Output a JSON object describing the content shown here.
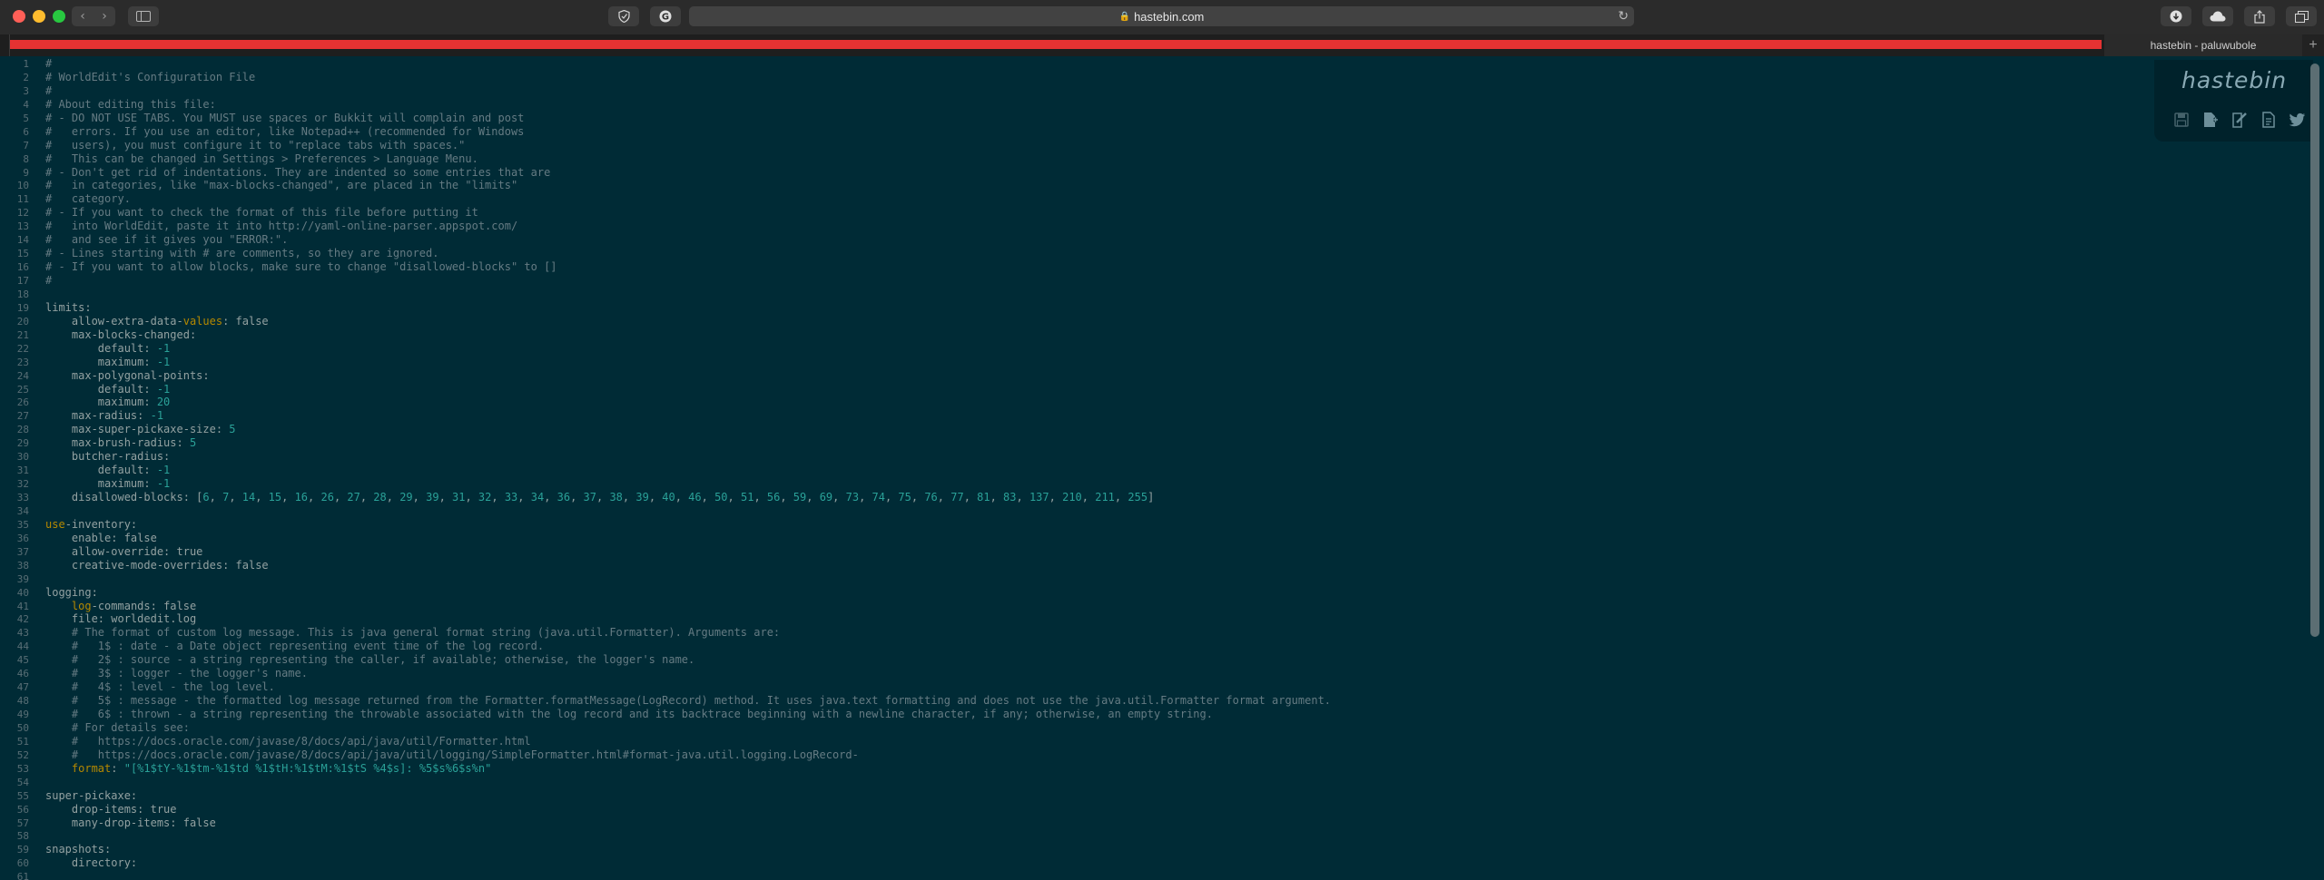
{
  "browser": {
    "url": "hastebin.com",
    "tab_title": "hastebin - paluwubole",
    "nav_back": "‹",
    "nav_forward": "›",
    "new_tab": "+"
  },
  "hastebin": {
    "logo": "hastebin",
    "icons": [
      "save-icon",
      "new-icon",
      "duplicate-icon",
      "raw-icon",
      "twitter-icon"
    ]
  },
  "code_lines": [
    {
      "n": "1",
      "parts": [
        [
          "cmt",
          "#"
        ]
      ]
    },
    {
      "n": "2",
      "parts": [
        [
          "cmt",
          "# WorldEdit's Configuration File"
        ]
      ]
    },
    {
      "n": "3",
      "parts": [
        [
          "cmt",
          "#"
        ]
      ]
    },
    {
      "n": "4",
      "parts": [
        [
          "cmt",
          "# About editing this file:"
        ]
      ]
    },
    {
      "n": "5",
      "parts": [
        [
          "cmt",
          "# - DO NOT USE TABS. You MUST use spaces or Bukkit will complain and post"
        ]
      ]
    },
    {
      "n": "6",
      "parts": [
        [
          "cmt",
          "#   errors. If you use an editor, like Notepad++ (recommended for Windows"
        ]
      ]
    },
    {
      "n": "7",
      "parts": [
        [
          "cmt",
          "#   users), you must configure it to \"replace tabs with spaces.\""
        ]
      ]
    },
    {
      "n": "8",
      "parts": [
        [
          "cmt",
          "#   This can be changed in Settings > Preferences > Language Menu."
        ]
      ]
    },
    {
      "n": "9",
      "parts": [
        [
          "cmt",
          "# - Don't get rid of indentations. They are indented so some entries that are"
        ]
      ]
    },
    {
      "n": "10",
      "parts": [
        [
          "cmt",
          "#   in categories, like \"max-blocks-changed\", are placed in the \"limits\""
        ]
      ]
    },
    {
      "n": "11",
      "parts": [
        [
          "cmt",
          "#   category."
        ]
      ]
    },
    {
      "n": "12",
      "parts": [
        [
          "cmt",
          "# - If you want to check the format of this file before putting it"
        ]
      ]
    },
    {
      "n": "13",
      "parts": [
        [
          "cmt",
          "#   into WorldEdit, paste it into http://yaml-online-parser.appspot.com/"
        ]
      ]
    },
    {
      "n": "14",
      "parts": [
        [
          "cmt",
          "#   and see if it gives you \"ERROR:\"."
        ]
      ]
    },
    {
      "n": "15",
      "parts": [
        [
          "cmt",
          "# - Lines starting with # are comments, so they are ignored."
        ]
      ]
    },
    {
      "n": "16",
      "parts": [
        [
          "cmt",
          "# - If you want to allow blocks, make sure to change \"disallowed-blocks\" to []"
        ]
      ]
    },
    {
      "n": "17",
      "parts": [
        [
          "cmt",
          "#"
        ]
      ]
    },
    {
      "n": "18",
      "parts": []
    },
    {
      "n": "19",
      "parts": [
        [
          "t",
          "limits:"
        ]
      ]
    },
    {
      "n": "20",
      "parts": [
        [
          "t",
          "    allow-extra-data-"
        ],
        [
          "kw",
          "values"
        ],
        [
          "t",
          ": false"
        ]
      ]
    },
    {
      "n": "21",
      "parts": [
        [
          "t",
          "    max-blocks-changed:"
        ]
      ]
    },
    {
      "n": "22",
      "parts": [
        [
          "t",
          "        default: "
        ],
        [
          "num",
          "-1"
        ]
      ]
    },
    {
      "n": "23",
      "parts": [
        [
          "t",
          "        maximum: "
        ],
        [
          "num",
          "-1"
        ]
      ]
    },
    {
      "n": "24",
      "parts": [
        [
          "t",
          "    max-polygonal-points:"
        ]
      ]
    },
    {
      "n": "25",
      "parts": [
        [
          "t",
          "        default: "
        ],
        [
          "num",
          "-1"
        ]
      ]
    },
    {
      "n": "26",
      "parts": [
        [
          "t",
          "        maximum: "
        ],
        [
          "num",
          "20"
        ]
      ]
    },
    {
      "n": "27",
      "parts": [
        [
          "t",
          "    max-radius: "
        ],
        [
          "num",
          "-1"
        ]
      ]
    },
    {
      "n": "28",
      "parts": [
        [
          "t",
          "    max-super-pickaxe-size: "
        ],
        [
          "num",
          "5"
        ]
      ]
    },
    {
      "n": "29",
      "parts": [
        [
          "t",
          "    max-brush-radius: "
        ],
        [
          "num",
          "5"
        ]
      ]
    },
    {
      "n": "30",
      "parts": [
        [
          "t",
          "    butcher-radius:"
        ]
      ]
    },
    {
      "n": "31",
      "parts": [
        [
          "t",
          "        default: "
        ],
        [
          "num",
          "-1"
        ]
      ]
    },
    {
      "n": "32",
      "parts": [
        [
          "t",
          "        maximum: "
        ],
        [
          "num",
          "-1"
        ]
      ]
    },
    {
      "n": "33",
      "parts": [
        [
          "t",
          "    disallowed-blocks: ["
        ],
        [
          "num",
          "6"
        ],
        [
          "t",
          ", "
        ],
        [
          "num",
          "7"
        ],
        [
          "t",
          ", "
        ],
        [
          "num",
          "14"
        ],
        [
          "t",
          ", "
        ],
        [
          "num",
          "15"
        ],
        [
          "t",
          ", "
        ],
        [
          "num",
          "16"
        ],
        [
          "t",
          ", "
        ],
        [
          "num",
          "26"
        ],
        [
          "t",
          ", "
        ],
        [
          "num",
          "27"
        ],
        [
          "t",
          ", "
        ],
        [
          "num",
          "28"
        ],
        [
          "t",
          ", "
        ],
        [
          "num",
          "29"
        ],
        [
          "t",
          ", "
        ],
        [
          "num",
          "39"
        ],
        [
          "t",
          ", "
        ],
        [
          "num",
          "31"
        ],
        [
          "t",
          ", "
        ],
        [
          "num",
          "32"
        ],
        [
          "t",
          ", "
        ],
        [
          "num",
          "33"
        ],
        [
          "t",
          ", "
        ],
        [
          "num",
          "34"
        ],
        [
          "t",
          ", "
        ],
        [
          "num",
          "36"
        ],
        [
          "t",
          ", "
        ],
        [
          "num",
          "37"
        ],
        [
          "t",
          ", "
        ],
        [
          "num",
          "38"
        ],
        [
          "t",
          ", "
        ],
        [
          "num",
          "39"
        ],
        [
          "t",
          ", "
        ],
        [
          "num",
          "40"
        ],
        [
          "t",
          ", "
        ],
        [
          "num",
          "46"
        ],
        [
          "t",
          ", "
        ],
        [
          "num",
          "50"
        ],
        [
          "t",
          ", "
        ],
        [
          "num",
          "51"
        ],
        [
          "t",
          ", "
        ],
        [
          "num",
          "56"
        ],
        [
          "t",
          ", "
        ],
        [
          "num",
          "59"
        ],
        [
          "t",
          ", "
        ],
        [
          "num",
          "69"
        ],
        [
          "t",
          ", "
        ],
        [
          "num",
          "73"
        ],
        [
          "t",
          ", "
        ],
        [
          "num",
          "74"
        ],
        [
          "t",
          ", "
        ],
        [
          "num",
          "75"
        ],
        [
          "t",
          ", "
        ],
        [
          "num",
          "76"
        ],
        [
          "t",
          ", "
        ],
        [
          "num",
          "77"
        ],
        [
          "t",
          ", "
        ],
        [
          "num",
          "81"
        ],
        [
          "t",
          ", "
        ],
        [
          "num",
          "83"
        ],
        [
          "t",
          ", "
        ],
        [
          "num",
          "137"
        ],
        [
          "t",
          ", "
        ],
        [
          "num",
          "210"
        ],
        [
          "t",
          ", "
        ],
        [
          "num",
          "211"
        ],
        [
          "t",
          ", "
        ],
        [
          "num",
          "255"
        ],
        [
          "t",
          "]"
        ]
      ]
    },
    {
      "n": "34",
      "parts": []
    },
    {
      "n": "35",
      "parts": [
        [
          "kw",
          "use"
        ],
        [
          "t",
          "-inventory:"
        ]
      ]
    },
    {
      "n": "36",
      "parts": [
        [
          "t",
          "    enable: false"
        ]
      ]
    },
    {
      "n": "37",
      "parts": [
        [
          "t",
          "    allow-override: true"
        ]
      ]
    },
    {
      "n": "38",
      "parts": [
        [
          "t",
          "    creative-mode-overrides: false"
        ]
      ]
    },
    {
      "n": "39",
      "parts": []
    },
    {
      "n": "40",
      "parts": [
        [
          "t",
          "logging:"
        ]
      ]
    },
    {
      "n": "41",
      "parts": [
        [
          "t",
          "    "
        ],
        [
          "kw",
          "log"
        ],
        [
          "t",
          "-commands: false"
        ]
      ]
    },
    {
      "n": "42",
      "parts": [
        [
          "t",
          "    file: worldedit.log"
        ]
      ]
    },
    {
      "n": "43",
      "parts": [
        [
          "cmt",
          "    # The format of custom log message. This is java general format string (java.util.Formatter). Arguments are:"
        ]
      ]
    },
    {
      "n": "44",
      "parts": [
        [
          "cmt",
          "    #   1$ : date - a Date object representing event time of the log record."
        ]
      ]
    },
    {
      "n": "45",
      "parts": [
        [
          "cmt",
          "    #   2$ : source - a string representing the caller, if available; otherwise, the logger's name."
        ]
      ]
    },
    {
      "n": "46",
      "parts": [
        [
          "cmt",
          "    #   3$ : logger - the logger's name."
        ]
      ]
    },
    {
      "n": "47",
      "parts": [
        [
          "cmt",
          "    #   4$ : level - the log level."
        ]
      ]
    },
    {
      "n": "48",
      "parts": [
        [
          "cmt",
          "    #   5$ : message - the formatted log message returned from the Formatter.formatMessage(LogRecord) method. It uses java.text formatting and does not use the java.util.Formatter format argument."
        ]
      ]
    },
    {
      "n": "49",
      "parts": [
        [
          "cmt",
          "    #   6$ : thrown - a string representing the throwable associated with the log record and its backtrace beginning with a newline character, if any; otherwise, an empty string."
        ]
      ]
    },
    {
      "n": "50",
      "parts": [
        [
          "cmt",
          "    # For details see:"
        ]
      ]
    },
    {
      "n": "51",
      "parts": [
        [
          "cmt",
          "    #   https://docs.oracle.com/javase/8/docs/api/java/util/Formatter.html"
        ]
      ]
    },
    {
      "n": "52",
      "parts": [
        [
          "cmt",
          "    #   https://docs.oracle.com/javase/8/docs/api/java/util/logging/SimpleFormatter.html#format-java.util.logging.LogRecord-"
        ]
      ]
    },
    {
      "n": "53",
      "parts": [
        [
          "t",
          "    "
        ],
        [
          "kw",
          "format"
        ],
        [
          "t",
          ": "
        ],
        [
          "str",
          "\"[%1$tY-%1$tm-%1$td %1$tH:%1$tM:%1$tS %4$s]: %5$s%6$s%n\""
        ]
      ]
    },
    {
      "n": "54",
      "parts": []
    },
    {
      "n": "55",
      "parts": [
        [
          "t",
          "super-pickaxe:"
        ]
      ]
    },
    {
      "n": "56",
      "parts": [
        [
          "t",
          "    drop-items: true"
        ]
      ]
    },
    {
      "n": "57",
      "parts": [
        [
          "t",
          "    many-drop-items: false"
        ]
      ]
    },
    {
      "n": "58",
      "parts": []
    },
    {
      "n": "59",
      "parts": [
        [
          "t",
          "snapshots:"
        ]
      ]
    },
    {
      "n": "60",
      "parts": [
        [
          "t",
          "    directory:"
        ]
      ]
    },
    {
      "n": "61",
      "parts": []
    }
  ]
}
